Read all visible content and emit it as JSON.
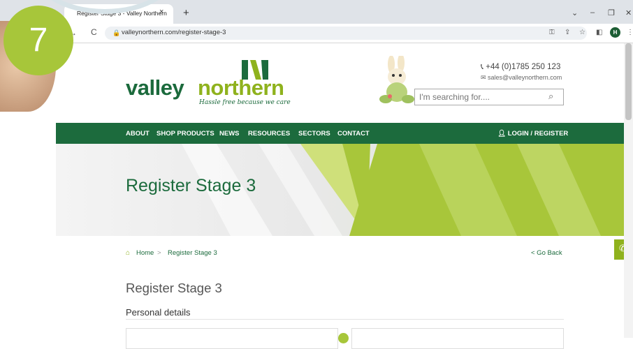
{
  "step_number": "7",
  "browser": {
    "tab_title": "Register Stage 3 - Valley Northern",
    "tab_close": "×",
    "new_tab": "+",
    "url": "valleynorthern.com/register-stage-3",
    "profile_initial": "H"
  },
  "site": {
    "logo_part1": "valley",
    "logo_part2": "northern",
    "tagline": "Hassle free because we care",
    "phone": "+44 (0)1785 250 123",
    "email": "sales@valleynorthern.com",
    "search_placeholder": "I'm searching for....",
    "colors": {
      "green": "#1c6b3d",
      "lime": "#8fb21d",
      "accent_lime": "#a7c63a"
    }
  },
  "nav": {
    "items": [
      "ABOUT",
      "SHOP PRODUCTS",
      "NEWS",
      "RESOURCES",
      "SECTORS",
      "CONTACT"
    ],
    "login": "LOGIN / REGISTER"
  },
  "banner": {
    "title": "Register Stage 3"
  },
  "breadcrumb": {
    "home": "Home",
    "separator": ">",
    "current": "Register Stage 3",
    "back": "< Go Back"
  },
  "page": {
    "heading": "Register Stage 3",
    "section": "Personal details"
  }
}
